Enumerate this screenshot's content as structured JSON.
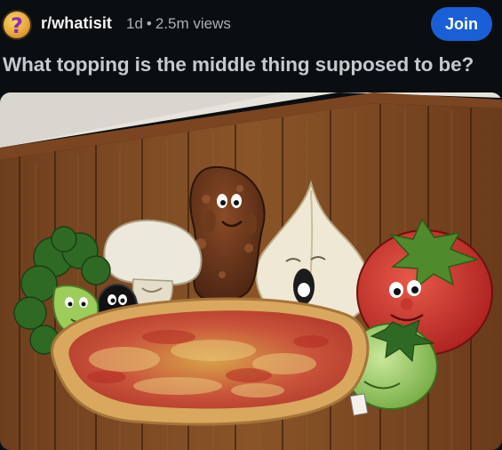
{
  "post": {
    "subreddit": "r/whatisit",
    "age": "1d",
    "separator": "•",
    "views": "2.5m views",
    "join_label": "Join",
    "title": "What topping is the middle thing supposed to be?",
    "avatar_glyph": "?"
  },
  "colors": {
    "background": "#0b0e10",
    "join_button": "#1a5fd6",
    "meta_text": "#a7b1b5",
    "title_text": "#c6cacc"
  },
  "photo": {
    "subject": "wooden wall decoration: pizza with cartoon topping characters (broccoli, mushroom, olive, brown character, garlic, tomato, green tomato)"
  }
}
